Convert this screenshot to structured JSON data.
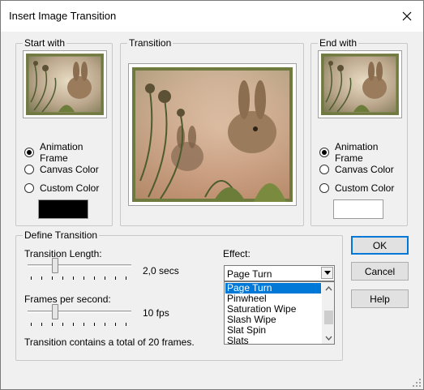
{
  "window": {
    "title": "Insert Image Transition",
    "close_icon": "close-icon"
  },
  "start_with": {
    "label": "Start with",
    "options": [
      "Animation Frame",
      "Canvas Color",
      "Custom Color"
    ],
    "selected": "Animation Frame",
    "custom_color": "#000000"
  },
  "transition_preview": {
    "label": "Transition"
  },
  "end_with": {
    "label": "End with",
    "options": [
      "Animation Frame",
      "Canvas Color",
      "Custom Color"
    ],
    "selected": "Animation Frame",
    "custom_color": "#ffffff"
  },
  "define_transition": {
    "label": "Define Transition",
    "length_label": "Transition Length:",
    "length_value": "2,0 secs",
    "length_slider_fraction": 0.25,
    "fps_label": "Frames per second:",
    "fps_value": "10 fps",
    "fps_slider_fraction": 0.25,
    "summary": "Transition contains a total of 20 frames."
  },
  "effect": {
    "label": "Effect:",
    "selected": "Page Turn",
    "options": [
      "Page Turn",
      "Pinwheel",
      "Saturation Wipe",
      "Slash Wipe",
      "Slat Spin",
      "Slats"
    ]
  },
  "buttons": {
    "ok": "OK",
    "cancel": "Cancel",
    "help": "Help"
  }
}
